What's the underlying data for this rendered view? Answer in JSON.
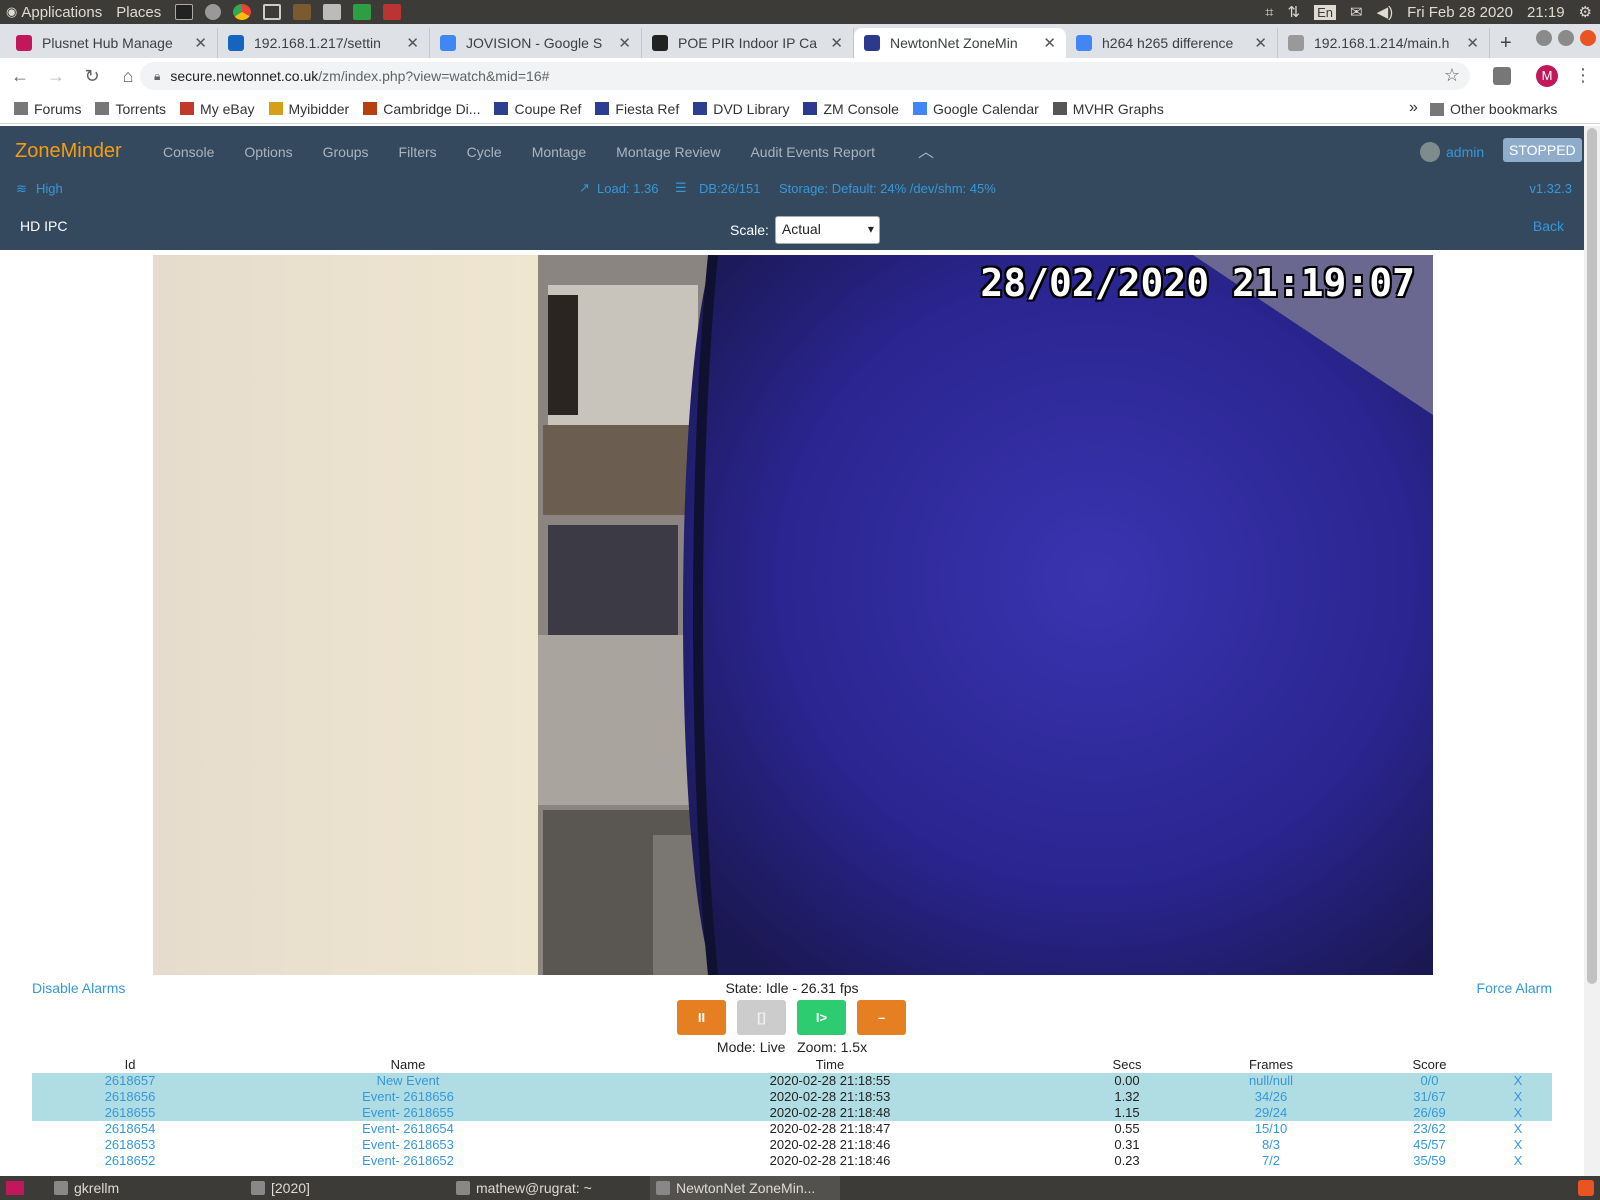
{
  "system_bar": {
    "applications": "Applications",
    "places": "Places",
    "keyboard_layout": "En",
    "datetime": "Fri Feb 28 2020",
    "clock": "21:19"
  },
  "tabs": [
    {
      "title": "Plusnet Hub Manage",
      "favicon": "plusnet-icon",
      "color": "#c2185b"
    },
    {
      "title": "192.168.1.217/settin",
      "favicon": "globe-icon",
      "color": "#1565c0"
    },
    {
      "title": "JOVISION - Google S",
      "favicon": "google-icon",
      "color": "#4285f4"
    },
    {
      "title": "POE PIR Indoor IP Ca",
      "favicon": "amazon-icon",
      "color": "#222222"
    },
    {
      "title": "NewtonNet ZoneMin",
      "favicon": "zm-icon",
      "color": "#2b3a8c",
      "active": true
    },
    {
      "title": "h264 h265 difference",
      "favicon": "google-icon",
      "color": "#4285f4"
    },
    {
      "title": "192.168.1.214/main.h",
      "favicon": "blank-icon",
      "color": "#999999"
    }
  ],
  "address": {
    "host": "secure.newtonnet.co.uk",
    "path": "/zm/index.php?view=watch&mid=16#"
  },
  "bookmarks": {
    "items": [
      "Forums",
      "Torrents",
      "My eBay",
      "Myibidder",
      "Cambridge Di...",
      "Coupe Ref",
      "Fiesta Ref",
      "DVD Library",
      "ZM Console",
      "Google Calendar",
      "MVHR Graphs"
    ],
    "overflow": "»",
    "other": "Other bookmarks"
  },
  "zm": {
    "brand": "ZoneMinder",
    "menu": [
      "Console",
      "Options",
      "Groups",
      "Filters",
      "Cycle",
      "Montage",
      "Montage Review",
      "Audit Events Report"
    ],
    "user": "admin",
    "run_state": "STOPPED",
    "bandwidth": "High",
    "load": "Load: 1.36",
    "db": "DB:26/151",
    "storage": "Storage: Default: 24% /dev/shm: 45%",
    "version": "v1.32.3",
    "monitor_name": "HD IPC",
    "scale_label": "Scale:",
    "scale_value": "Actual",
    "back": "Back"
  },
  "video": {
    "timestamp": "28/02/2020 21:19:07"
  },
  "controls": {
    "disable_alarms": "Disable Alarms",
    "force_alarm": "Force Alarm",
    "state": "State: Idle - 26.31 fps",
    "pause": "II",
    "stop": "[]",
    "play": "I>",
    "zoom_out": "–",
    "mode": "Mode: Live",
    "zoom": "Zoom: 1.5x"
  },
  "events": {
    "columns": [
      "Id",
      "Name",
      "Time",
      "Secs",
      "Frames",
      "Score"
    ],
    "rows": [
      {
        "id": "2618657",
        "name": "New Event",
        "time": "2020-02-28 21:18:55",
        "secs": "0.00",
        "frames": "null/null",
        "score": "0/0",
        "x": "X",
        "selected": true
      },
      {
        "id": "2618656",
        "name": "Event- 2618656",
        "time": "2020-02-28 21:18:53",
        "secs": "1.32",
        "frames": "34/26",
        "score": "31/67",
        "x": "X",
        "selected": true
      },
      {
        "id": "2618655",
        "name": "Event- 2618655",
        "time": "2020-02-28 21:18:48",
        "secs": "1.15",
        "frames": "29/24",
        "score": "26/69",
        "x": "X",
        "selected": true
      },
      {
        "id": "2618654",
        "name": "Event- 2618654",
        "time": "2020-02-28 21:18:47",
        "secs": "0.55",
        "frames": "15/10",
        "score": "23/62",
        "x": "X"
      },
      {
        "id": "2618653",
        "name": "Event- 2618653",
        "time": "2020-02-28 21:18:46",
        "secs": "0.31",
        "frames": "8/3",
        "score": "45/57",
        "x": "X"
      },
      {
        "id": "2618652",
        "name": "Event- 2618652",
        "time": "2020-02-28 21:18:46",
        "secs": "0.23",
        "frames": "7/2",
        "score": "35/59",
        "x": "X"
      }
    ]
  },
  "taskbar": [
    "gkrellm",
    "[2020]",
    "mathew@rugrat: ~",
    "NewtonNet ZoneMin..."
  ]
}
